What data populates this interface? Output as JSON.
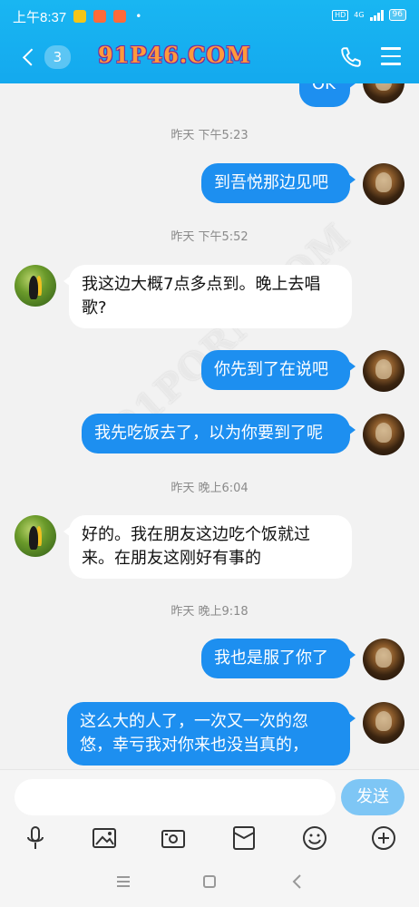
{
  "status_bar": {
    "time": "上午8:37",
    "network": "4G",
    "hd": "HD",
    "battery": "96",
    "dot": "•"
  },
  "header": {
    "unread_count": "3",
    "title": "91P46.COM"
  },
  "watermark": "91PORN.COM",
  "messages": [
    {
      "type": "out",
      "text": "OK"
    },
    {
      "type": "time",
      "text": "昨天 下午5:23"
    },
    {
      "type": "out",
      "text": "到吾悦那边见吧"
    },
    {
      "type": "time",
      "text": "昨天 下午5:52"
    },
    {
      "type": "in",
      "text": "我这边大概7点多点到。晚上去唱歌?"
    },
    {
      "type": "out",
      "text": "你先到了在说吧"
    },
    {
      "type": "out",
      "text": "我先吃饭去了，以为你要到了呢"
    },
    {
      "type": "time",
      "text": "昨天 晚上6:04"
    },
    {
      "type": "in",
      "text": "好的。我在朋友这边吃个饭就过来。在朋友这刚好有事的"
    },
    {
      "type": "time",
      "text": "昨天 晚上9:18"
    },
    {
      "type": "out",
      "text": "我也是服了你了"
    },
    {
      "type": "out",
      "text": "这么大的人了，一次又一次的忽悠，幸亏我对你来也没当真的，"
    }
  ],
  "input": {
    "placeholder": "",
    "send_label": "发送"
  },
  "toolbar": [
    "mic-icon",
    "image-icon",
    "camera-icon",
    "red-packet-icon",
    "emoji-icon",
    "plus-icon"
  ],
  "colors": {
    "header": "#14a9ee",
    "bubble_out": "#1d8ff0",
    "bubble_in": "#ffffff",
    "send_button": "#7ec6f5"
  }
}
